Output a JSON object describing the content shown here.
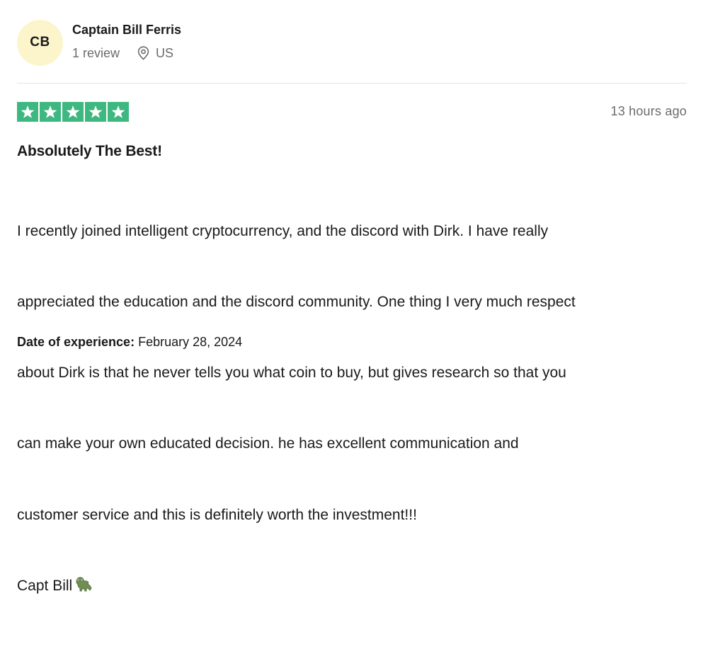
{
  "reviewer": {
    "initials": "CB",
    "name": "Captain Bill Ferris",
    "review_count": "1 review",
    "country": "US"
  },
  "rating": {
    "stars": 5,
    "max_stars": 5,
    "star_color": "#3eb780"
  },
  "review": {
    "posted": "13 hours ago",
    "title": "Absolutely The Best!",
    "body_lines": [
      "I recently joined intelligent cryptocurrency, and the discord with Dirk. I have really",
      "appreciated the education and the discord community. One thing I very much respect",
      "about Dirk is that he never tells you what coin to buy, but gives research so that you",
      "can make your own educated decision. he has excellent communication and",
      "customer service and this is definitely worth the investment!!!"
    ],
    "signature": "Capt Bill",
    "signature_emoji": "crocodile-emoji"
  },
  "experience": {
    "label": "Date of experience:",
    "date": "February 28, 2024"
  },
  "colors": {
    "avatar_bg": "#fcf5cc",
    "muted_text": "#6b6b6b",
    "divider": "#e5e5dd"
  }
}
